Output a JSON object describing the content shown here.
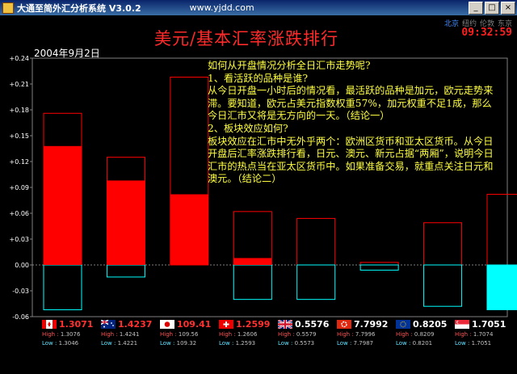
{
  "window": {
    "title": "大通至简外汇分析系统 V3.0.2",
    "url": "www.yjdd.com",
    "buttons": {
      "minimize": "_",
      "maximize": "□",
      "close": "×"
    }
  },
  "cities": [
    "北京",
    "纽约",
    "伦敦",
    "东京"
  ],
  "active_city": "北京",
  "clock": "09:32:59",
  "main_title": "美元/基本汇率涨跌排行",
  "date": "2004年9月2日",
  "analysis": [
    "如何从开盘情况分析全日汇市走势呢?",
    "1、看活跃的品种是谁?",
    "从今日开盘一小时后的情况看，最活跃的品种是加元，欧元走势来滞。要知道，欧元占美元指数权重57%，加元权重不足1成，那么今日汇市又将是无方向的一天。（结论一）",
    "2、板块效应如何?",
    "板块效应在汇市中无外乎两个：欧洲区货币和亚太区货币。从今日开盘后汇率涨跌排行看，日元、澳元、新元占据“两厢”，说明今日汇市的热点当在亚太区货币中。如果准备交易，就重点关注日元和澳元。（结论二）"
  ],
  "chart_data": {
    "type": "bar",
    "ylim": [
      -0.06,
      0.24
    ],
    "yticks": [
      "+0.24",
      "+0.21",
      "+0.18",
      "+0.15",
      "+0.12",
      "+0.09",
      "+0.06",
      "+0.03",
      "0.00",
      "-0.03",
      "-0.06"
    ],
    "categories": [
      "CAD",
      "AUD",
      "JPY",
      "CHF",
      "GBP",
      "HKD",
      "EUR",
      "SGD"
    ],
    "current_values": [
      0.138,
      0.098,
      0.082,
      0.008,
      0.0,
      0.0,
      0.0,
      -0.052
    ],
    "high_values": [
      0.176,
      0.125,
      0.218,
      0.062,
      0.054,
      0.003,
      0.049,
      0.082
    ],
    "low_values": [
      -0.052,
      -0.014,
      0.0,
      -0.04,
      -0.04,
      -0.006,
      -0.048,
      -0.052
    ],
    "colors": {
      "positive": "#ff0000",
      "negative": "#00ffff",
      "high_outline": "#ff0000",
      "low_outline": "#00ffff",
      "axis": "#808080",
      "tick_text": "#ffffff"
    }
  },
  "currencies": [
    {
      "flag": "canada-flag-icon",
      "rate": "1.3071",
      "high": "1.3076",
      "low": "1.3046",
      "highlight": true
    },
    {
      "flag": "australia-flag-icon",
      "rate": "1.4237",
      "high": "1.4241",
      "low": "1.4221",
      "highlight": true
    },
    {
      "flag": "japan-flag-icon",
      "rate": "109.41",
      "high": "109.56",
      "low": "109.32",
      "highlight": true
    },
    {
      "flag": "switzerland-flag-icon",
      "rate": "1.2599",
      "high": "1.2606",
      "low": "1.2593",
      "highlight": true
    },
    {
      "flag": "uk-flag-icon",
      "rate": "0.5576",
      "high": "0.5579",
      "low": "0.5573",
      "highlight": false
    },
    {
      "flag": "hongkong-flag-icon",
      "rate": "7.7992",
      "high": "7.7996",
      "low": "7.7987",
      "highlight": false
    },
    {
      "flag": "eu-flag-icon",
      "rate": "0.8205",
      "high": "0.8209",
      "low": "0.8201",
      "highlight": false
    },
    {
      "flag": "singapore-flag-icon",
      "rate": "1.7051",
      "high": "1.7074",
      "low": "1.7051",
      "highlight": false
    }
  ],
  "labels": {
    "high": "High :",
    "low": "Low :"
  }
}
